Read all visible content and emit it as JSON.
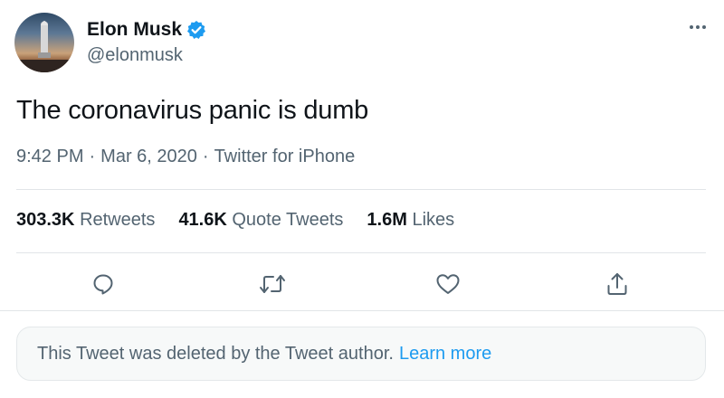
{
  "author": {
    "display_name": "Elon Musk",
    "handle": "@elonmusk",
    "verified": true,
    "avatar_icon": "starship-avatar"
  },
  "tweet": {
    "text": "The coronavirus panic is dumb",
    "time": "9:42 PM",
    "date": "Mar 6, 2020",
    "source": "Twitter for iPhone",
    "separator": "·"
  },
  "stats": {
    "retweets_count": "303.3K",
    "retweets_label": "Retweets",
    "quotes_count": "41.6K",
    "quotes_label": "Quote Tweets",
    "likes_count": "1.6M",
    "likes_label": "Likes"
  },
  "actions": {
    "reply_icon": "reply-icon",
    "retweet_icon": "retweet-icon",
    "like_icon": "heart-icon",
    "share_icon": "share-icon"
  },
  "notice": {
    "text": "This Tweet was deleted by the Tweet author.",
    "link": "Learn more"
  },
  "colors": {
    "accent": "#1d9bf0",
    "secondary_text": "#536471",
    "primary_text": "#0f1419"
  }
}
